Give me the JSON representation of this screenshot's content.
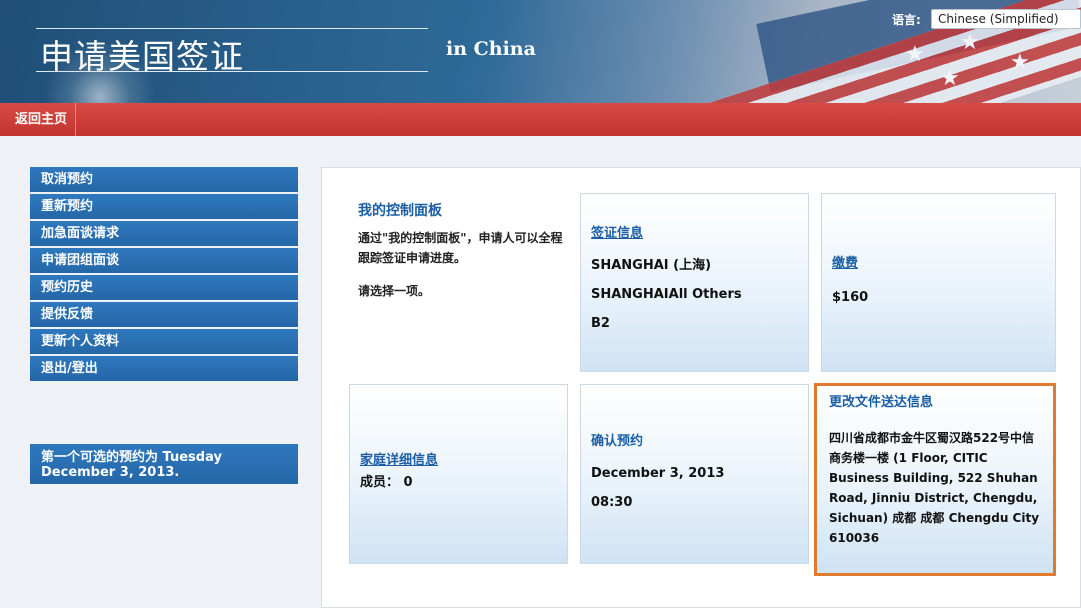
{
  "header": {
    "title": "申请美国签证",
    "subtitle": "in China",
    "language_label": "语言:",
    "language_selected": "Chinese (Simplified)"
  },
  "nav": {
    "home": "返回主页"
  },
  "sidebar": {
    "items": [
      {
        "label": "取消预约"
      },
      {
        "label": "重新预约"
      },
      {
        "label": "加急面谈请求"
      },
      {
        "label": "申请团组面谈"
      },
      {
        "label": "预约历史"
      },
      {
        "label": "提供反馈"
      },
      {
        "label": "更新个人资料"
      },
      {
        "label": "退出/登出"
      }
    ],
    "note": "第一个可选的预约为 Tuesday December 3, 2013."
  },
  "dashboard": {
    "title": "我的控制面板",
    "description": "通过\"我的控制面板\"，申请人可以全程跟踪签证申请进度。",
    "choose": "请选择一项。"
  },
  "cards": {
    "visa": {
      "link": "签证信息",
      "lines": [
        "SHANGHAI (上海)",
        "SHANGHAIAll Others",
        "B2"
      ]
    },
    "payment": {
      "link": "缴费",
      "amount": "$160"
    },
    "family": {
      "link": "家庭详细信息",
      "members_label": "成员：",
      "members_value": "0"
    },
    "appointment": {
      "title": "确认预约",
      "date": "December 3, 2013",
      "time": "08:30"
    },
    "delivery": {
      "title": "更改文件送达信息",
      "address": "四川省成都市金牛区蜀汉路522号中信商务楼一楼 (1 Floor, CITIC Business Building, 522 Shuhan Road, Jinniu District, Chengdu, Sichuan) 成都 成都 Chengdu City 610036"
    }
  },
  "colors": {
    "nav_red": "#c1352f",
    "sidebar_blue": "#2467a8",
    "link_blue": "#1b5ea6",
    "highlight_orange": "#e07a2e"
  }
}
